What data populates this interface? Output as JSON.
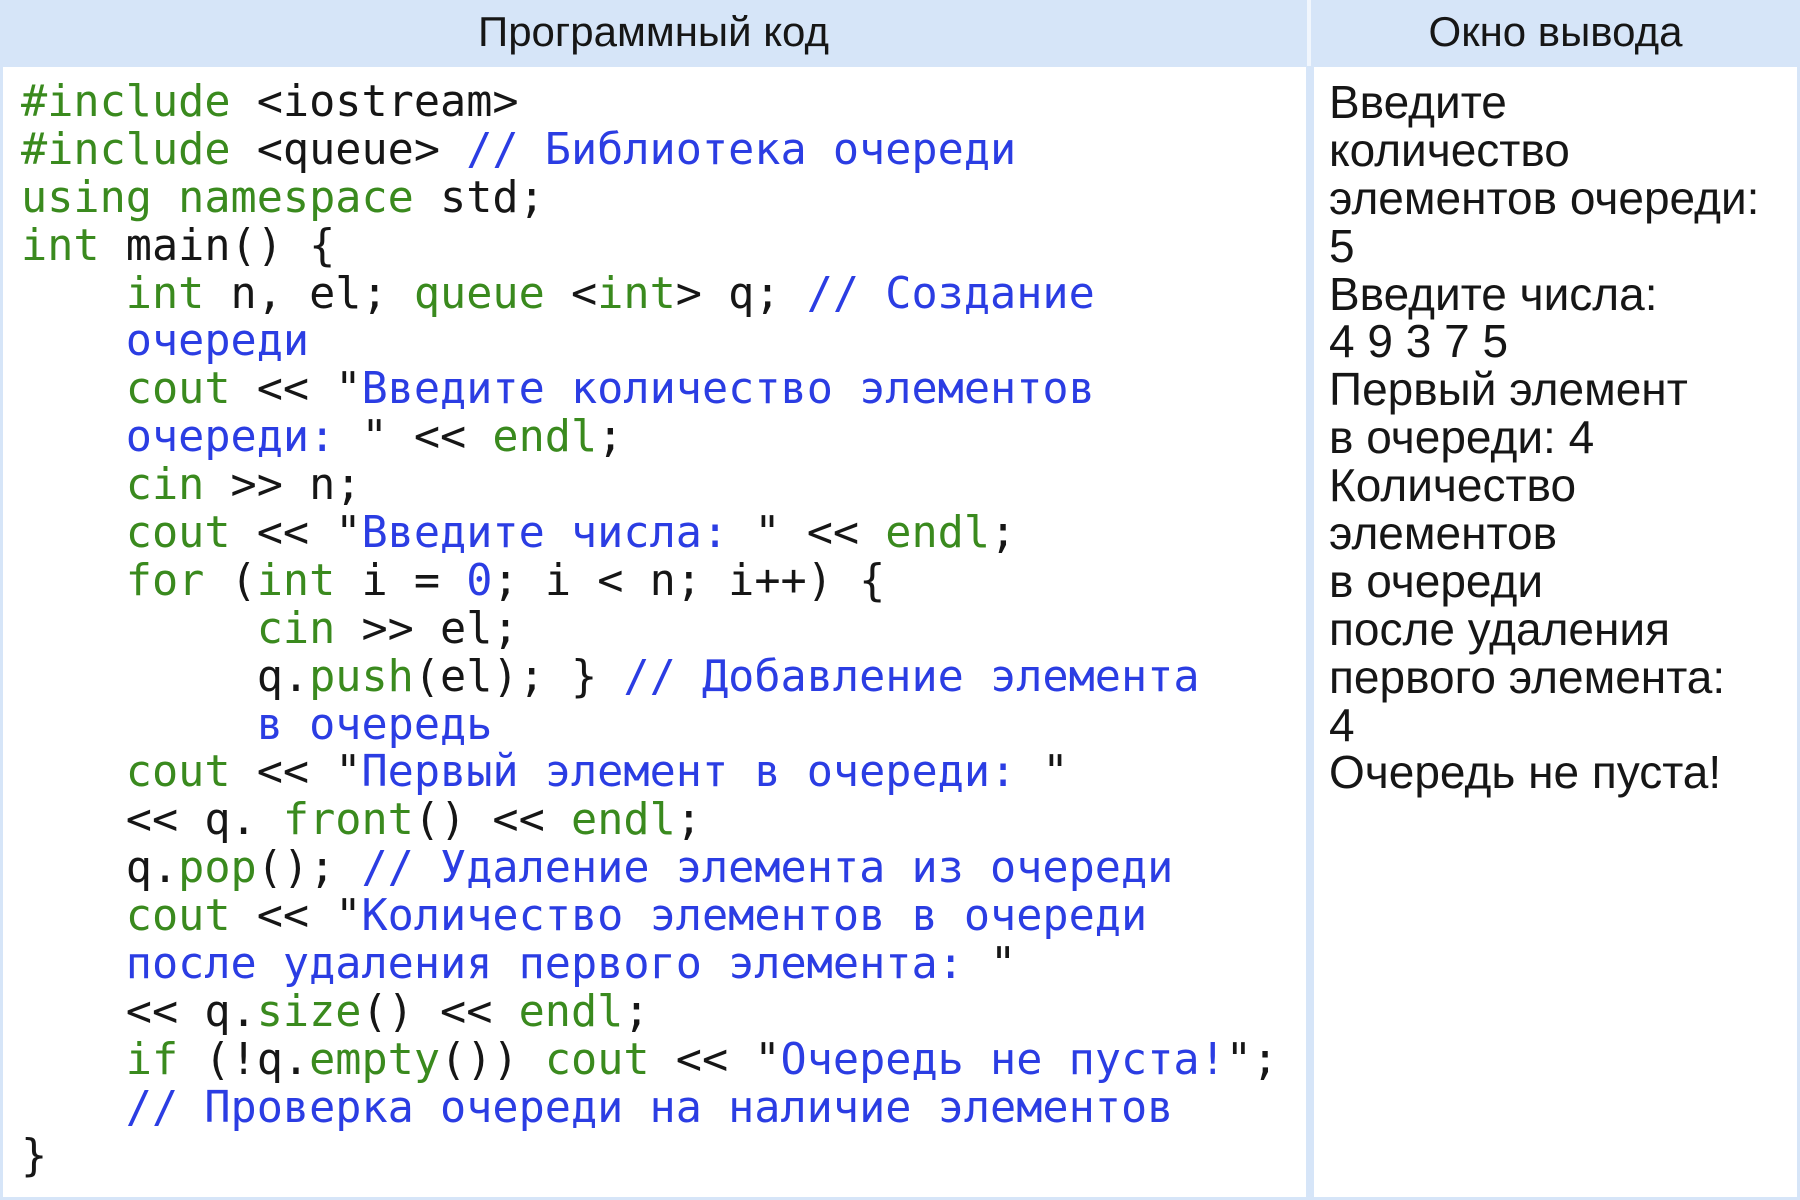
{
  "header": {
    "code_title": "Программный код",
    "output_title": "Окно вывода"
  },
  "colors": {
    "header_bg": "#d6e5f8",
    "panel_bg": "#ffffff",
    "keyword": "#3a8a1e",
    "comment_string": "#2b3de3",
    "plain": "#161616"
  },
  "code": {
    "lines": [
      [
        [
          "#include",
          "#3a8a1e"
        ],
        [
          " <iostream>",
          "#161616"
        ]
      ],
      [
        [
          "#include",
          "#3a8a1e"
        ],
        [
          " <queue> ",
          "#161616"
        ],
        [
          "// Библиотека очереди",
          "#2b3de3"
        ]
      ],
      [
        [
          "using namespace",
          "#3a8a1e"
        ],
        [
          " std;",
          "#161616"
        ]
      ],
      [
        [
          "int",
          "#3a8a1e"
        ],
        [
          " main() {",
          "#161616"
        ]
      ],
      [
        [
          "    ",
          "#161616"
        ],
        [
          "int",
          "#3a8a1e"
        ],
        [
          " n, el; ",
          "#161616"
        ],
        [
          "queue",
          "#3a8a1e"
        ],
        [
          " <",
          "#161616"
        ],
        [
          "int",
          "#3a8a1e"
        ],
        [
          "> q; ",
          "#161616"
        ],
        [
          "// Создание",
          "#2b3de3"
        ]
      ],
      [
        [
          "    ",
          "#161616"
        ],
        [
          "очереди",
          "#2b3de3"
        ]
      ],
      [
        [
          "    ",
          "#161616"
        ],
        [
          "cout",
          "#3a8a1e"
        ],
        [
          " << \"",
          "#161616"
        ],
        [
          "Введите количество элементов",
          "#2b3de3"
        ]
      ],
      [
        [
          "    ",
          "#161616"
        ],
        [
          "очереди: ",
          "#2b3de3"
        ],
        [
          "\" << ",
          "#161616"
        ],
        [
          "endl",
          "#3a8a1e"
        ],
        [
          ";",
          "#161616"
        ]
      ],
      [
        [
          "    ",
          "#161616"
        ],
        [
          "cin",
          "#3a8a1e"
        ],
        [
          " >> n;",
          "#161616"
        ]
      ],
      [
        [
          "    ",
          "#161616"
        ],
        [
          "cout",
          "#3a8a1e"
        ],
        [
          " << \"",
          "#161616"
        ],
        [
          "Введите числа: ",
          "#2b3de3"
        ],
        [
          "\" << ",
          "#161616"
        ],
        [
          "endl",
          "#3a8a1e"
        ],
        [
          ";",
          "#161616"
        ]
      ],
      [
        [
          "    ",
          "#161616"
        ],
        [
          "for",
          "#3a8a1e"
        ],
        [
          " (",
          "#161616"
        ],
        [
          "int",
          "#3a8a1e"
        ],
        [
          " i = ",
          "#161616"
        ],
        [
          "0",
          "#2b3de3"
        ],
        [
          "; i < n; i++) {",
          "#161616"
        ]
      ],
      [
        [
          "         ",
          "#161616"
        ],
        [
          "cin",
          "#3a8a1e"
        ],
        [
          " >> el;",
          "#161616"
        ]
      ],
      [
        [
          "         q.",
          "#161616"
        ],
        [
          "push",
          "#3a8a1e"
        ],
        [
          "(el); } ",
          "#161616"
        ],
        [
          "// Добавление элемента",
          "#2b3de3"
        ]
      ],
      [
        [
          "         ",
          "#161616"
        ],
        [
          "в очередь",
          "#2b3de3"
        ]
      ],
      [
        [
          "    ",
          "#161616"
        ],
        [
          "cout",
          "#3a8a1e"
        ],
        [
          " << \"",
          "#161616"
        ],
        [
          "Первый элемент в очереди: ",
          "#2b3de3"
        ],
        [
          "\"",
          "#161616"
        ]
      ],
      [
        [
          "    << q. ",
          "#161616"
        ],
        [
          "front",
          "#3a8a1e"
        ],
        [
          "() << ",
          "#161616"
        ],
        [
          "endl",
          "#3a8a1e"
        ],
        [
          ";",
          "#161616"
        ]
      ],
      [
        [
          "    q.",
          "#161616"
        ],
        [
          "pop",
          "#3a8a1e"
        ],
        [
          "(); ",
          "#161616"
        ],
        [
          "// Удаление элемента из очереди",
          "#2b3de3"
        ]
      ],
      [
        [
          "    ",
          "#161616"
        ],
        [
          "cout",
          "#3a8a1e"
        ],
        [
          " << \"",
          "#161616"
        ],
        [
          "Количество элементов в очереди",
          "#2b3de3"
        ]
      ],
      [
        [
          "    ",
          "#161616"
        ],
        [
          "после удаления первого элемента: ",
          "#2b3de3"
        ],
        [
          "\"",
          "#161616"
        ]
      ],
      [
        [
          "    << q.",
          "#161616"
        ],
        [
          "size",
          "#3a8a1e"
        ],
        [
          "() << ",
          "#161616"
        ],
        [
          "endl",
          "#3a8a1e"
        ],
        [
          ";",
          "#161616"
        ]
      ],
      [
        [
          "    ",
          "#161616"
        ],
        [
          "if",
          "#3a8a1e"
        ],
        [
          " (!q.",
          "#161616"
        ],
        [
          "empty",
          "#3a8a1e"
        ],
        [
          "()) ",
          "#161616"
        ],
        [
          "cout",
          "#3a8a1e"
        ],
        [
          " << \"",
          "#161616"
        ],
        [
          "Очередь не пуста!",
          "#2b3de3"
        ],
        [
          "\";",
          "#161616"
        ]
      ],
      [
        [
          "    ",
          "#161616"
        ],
        [
          "// Проверка очереди на наличие элементов",
          "#2b3de3"
        ]
      ],
      [
        [
          "}",
          "#161616"
        ]
      ]
    ]
  },
  "output": {
    "lines": [
      "Введите",
      "количество",
      "элементов очереди:",
      "5",
      "Введите числа:",
      "4 9 3 7 5",
      "Первый элемент",
      "в очереди: 4",
      "Количество",
      "элементов",
      "в очереди",
      "после удаления",
      "первого элемента:",
      "4",
      "Очередь не пуста!"
    ]
  }
}
